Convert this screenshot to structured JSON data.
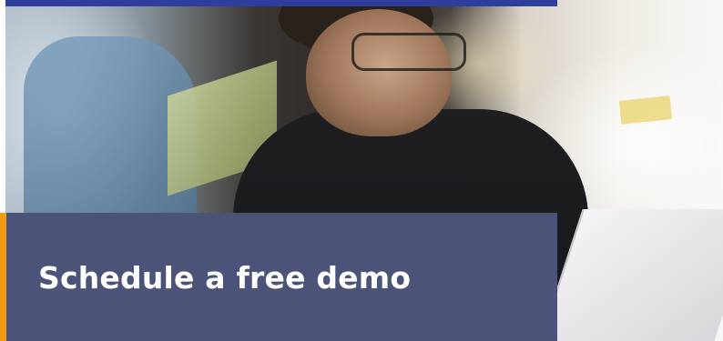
{
  "banner": {
    "cta_title": "Schedule a free demo",
    "accent_color": "#f39c12",
    "panel_color": "#4b5379",
    "top_bar_color": "#2f3e9e"
  },
  "hero_image": {
    "icon": "photo-person-at-laptop"
  }
}
